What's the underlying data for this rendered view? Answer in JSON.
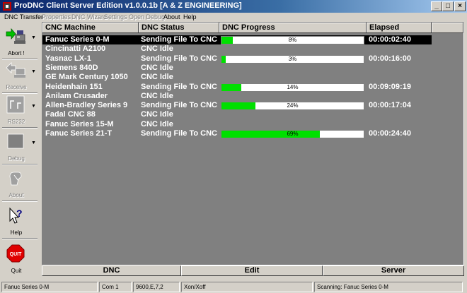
{
  "window": {
    "title": "ProDNC Client Server Edition v1.0.0.1b [A & Z ENGINEERING]",
    "minimize_glyph": "_",
    "maximize_glyph": "□",
    "close_glyph": "×"
  },
  "menu": {
    "dnc_transfer": "DNC Transfer",
    "properties": "Properties",
    "dnc_wizard": "DNC Wizard",
    "settings": "Settings",
    "open_debug": "Open Debug",
    "about": "About",
    "help": "Help"
  },
  "toolbar": {
    "abort": "Abort !",
    "receive": "Receive",
    "rs232": "RS232",
    "debug": "Debug",
    "about": "About",
    "help": "Help",
    "quit": "Quit",
    "quit_icon_text": "QUIT"
  },
  "grid": {
    "columns": [
      "CNC Machine",
      "DNC Status",
      "DNC Progress",
      "Elapsed"
    ],
    "rows": [
      {
        "machine": "Fanuc Series 0-M",
        "status": "Sending File To CNC",
        "progress": 8,
        "progress_text": "8%",
        "elapsed": "00:00:02:40"
      },
      {
        "machine": "Cincinatti A2100",
        "status": "CNC Idle",
        "elapsed": ""
      },
      {
        "machine": "Yasnac LX-1",
        "status": "Sending File To CNC",
        "progress": 3,
        "progress_text": "3%",
        "elapsed": "00:00:16:00"
      },
      {
        "machine": "Siemens 840D",
        "status": "CNC Idle",
        "elapsed": ""
      },
      {
        "machine": "GE Mark Century 1050",
        "status": "CNC Idle",
        "elapsed": ""
      },
      {
        "machine": "Heidenhain 151",
        "status": "Sending File To CNC",
        "progress": 14,
        "progress_text": "14%",
        "elapsed": "00:09:09:19"
      },
      {
        "machine": "Anilam Crusader",
        "status": "CNC Idle",
        "elapsed": ""
      },
      {
        "machine": "Allen-Bradley Series 9",
        "status": "Sending File To CNC",
        "progress": 24,
        "progress_text": "24%",
        "elapsed": "00:00:17:04"
      },
      {
        "machine": "Fadal CNC 88",
        "status": "CNC Idle",
        "elapsed": ""
      },
      {
        "machine": "Fanuc Series 15-M",
        "status": "CNC Idle",
        "elapsed": ""
      },
      {
        "machine": "Fanuc Series 21-T",
        "status": "Sending File To CNC",
        "progress": 69,
        "progress_text": "69%",
        "elapsed": "00:00:24:40"
      }
    ],
    "selected_row": 0
  },
  "tabs": {
    "dnc": "DNC",
    "edit": "Edit",
    "server": "Server"
  },
  "status": {
    "machine": "Fanuc Series 0-M",
    "port": "Com 1",
    "settings": "9600,E,7,2",
    "flow": "Xon/Xoff",
    "scanning": "Scanning:  Fanuc Series 0-M"
  },
  "colors": {
    "progress_fill": "#00e000",
    "selected_row_bg": "#000000",
    "grid_bg": "#808080",
    "quit_red": "#e00000"
  },
  "icons": [
    "app-icon",
    "abort-transfer-icon",
    "receive-icon",
    "rs232-icon",
    "debug-icon",
    "about-icon",
    "help-icon",
    "quit-icon"
  ]
}
